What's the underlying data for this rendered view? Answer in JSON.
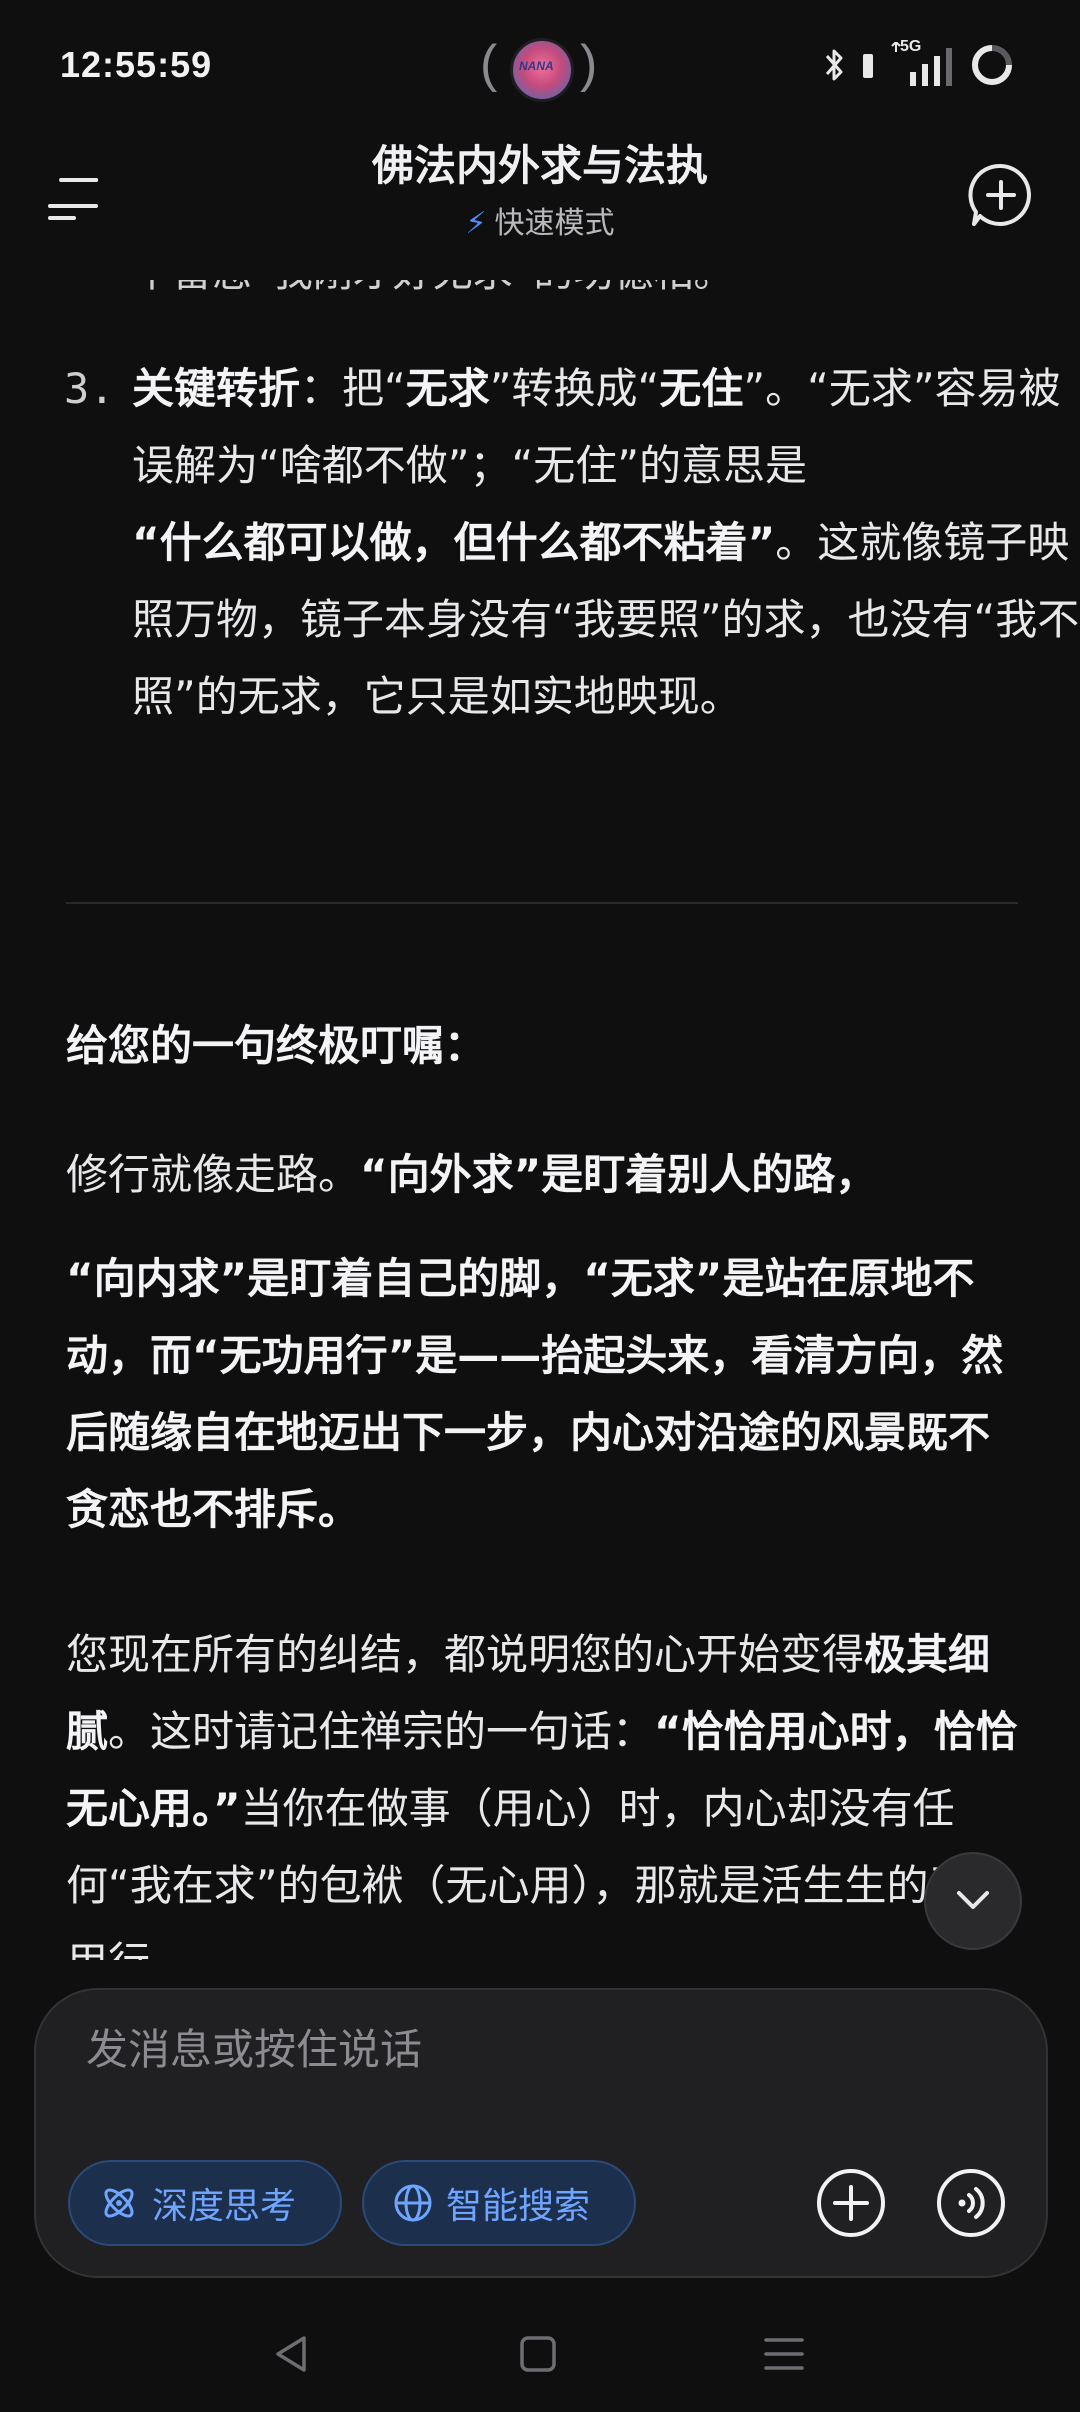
{
  "status_bar": {
    "time": "12:55:59",
    "avatar_text": "NANA",
    "network": "5G"
  },
  "header": {
    "title": "佛法内外求与法执",
    "mode": "快速模式"
  },
  "content": {
    "cut_line": "不留恋“我刚才好无求”的功德相。",
    "item3": {
      "number": "3.",
      "label": "关键转折",
      "t1": "：把“",
      "b1": "无求",
      "t2": "”转换成“",
      "b2": "无住",
      "t3": "”。“无求”容易被误解为“啥都不做”；“无住”的意思是",
      "b3": "“什么都可以做，但什么都不粘着”",
      "t4": "。这就像镜子映照万物，镜子本身没有“我要照”的求，也没有“我不照”的无求，它只是如实地映现。"
    },
    "section_title": "给您的一句终极叮嘱：",
    "para1": {
      "t1": "修行就像走路。",
      "b1": "“向外求”是盯着别人的路，"
    },
    "para2": {
      "b1": "“向内求”是盯着自己的脚，“无求”是站在原地不动，而“无功用行”是——抬起头来，看清方向，然后随缘自在地迈出下一步，内心对沿途的风景既不贪恋也不排斥。"
    },
    "para3": {
      "t1": "您现在所有的纠结，都说明您的心开始变得",
      "b1": "极其细腻",
      "t2": "。这时请记住禅宗的一句话：",
      "b2": "“恰恰用心时，恰恰无心用。”",
      "t3": "当你在做事（用心）时，内心却没有任何“我在求”的包袱（无心用），那就是活生生的无功用行。"
    }
  },
  "input": {
    "placeholder": "发消息或按住说话",
    "deep_think": "深度思考",
    "smart_search": "智能搜索"
  },
  "icons": {
    "menu": "menu-icon",
    "new_chat": "new-chat-icon",
    "bolt": "bolt-icon",
    "scroll_down": "chevron-down-icon",
    "deep_think": "atom-icon",
    "smart_search": "globe-icon",
    "plus": "plus-icon",
    "voice": "voice-icon",
    "nav_back": "back-icon",
    "nav_home": "home-icon",
    "nav_menu": "recents-icon"
  },
  "colors": {
    "background": "#0f0f10",
    "accent": "#6fa5ff",
    "chip_bg": "#1c2f4c"
  }
}
